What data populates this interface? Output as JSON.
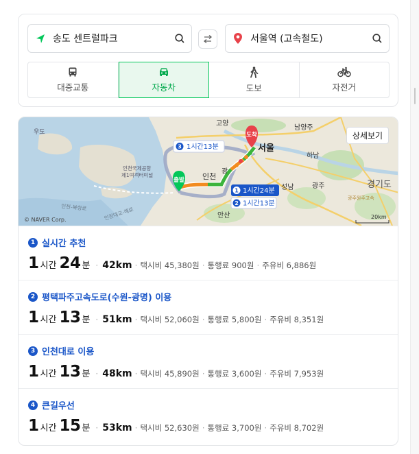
{
  "search": {
    "origin": "송도 센트럴파크",
    "destination": "서울역 (고속철도)"
  },
  "modes": [
    {
      "label": "대중교통",
      "icon": "bus-icon"
    },
    {
      "label": "자동차",
      "icon": "car-icon"
    },
    {
      "label": "도보",
      "icon": "walk-icon"
    },
    {
      "label": "자전거",
      "icon": "bicycle-icon"
    }
  ],
  "selected_mode": "자동차",
  "map": {
    "detail_button": "상세보기",
    "copyright": "© NAVER Corp.",
    "scale": "20km",
    "start_marker": "출발",
    "end_marker": "도착",
    "labels": {
      "seoul": "서울",
      "incheon": "인천",
      "goyang": "고양",
      "namyangju": "남양주",
      "hanam": "하남",
      "seongnam": "성남",
      "gwangju": "광주",
      "gyeonggi": "경기도",
      "ansan": "안산",
      "gwangmyeong": "광",
      "mudo": "우도",
      "airport": "인천국제공항\n제1여객터미널",
      "bridge1": "인천-북항로",
      "bridge2": "인천대교-해로",
      "gwangjuwonju": "광주원주고속"
    },
    "callouts": [
      {
        "num": "3",
        "text": "1시간13분"
      },
      {
        "num": "1",
        "text": "1시간24분"
      },
      {
        "num": "2",
        "text": "1시간13분"
      }
    ]
  },
  "routes": [
    {
      "num": "1",
      "title": "실시간 추천",
      "hours": "1",
      "hour_unit": "시간",
      "minutes": "24",
      "minute_unit": "분",
      "distance": "42km",
      "taxi": "택시비 45,380원",
      "toll": "통행료 900원",
      "fuel": "주유비 6,886원"
    },
    {
      "num": "2",
      "title": "평택파주고속도로(수원-광명) 이용",
      "hours": "1",
      "hour_unit": "시간",
      "minutes": "13",
      "minute_unit": "분",
      "distance": "51km",
      "taxi": "택시비 52,060원",
      "toll": "통행료 5,800원",
      "fuel": "주유비 8,351원"
    },
    {
      "num": "3",
      "title": "인천대로 이용",
      "hours": "1",
      "hour_unit": "시간",
      "minutes": "13",
      "minute_unit": "분",
      "distance": "48km",
      "taxi": "택시비 45,890원",
      "toll": "통행료 3,600원",
      "fuel": "주유비 7,953원"
    },
    {
      "num": "4",
      "title": "큰길우선",
      "hours": "1",
      "hour_unit": "시간",
      "minutes": "15",
      "minute_unit": "분",
      "distance": "53km",
      "taxi": "택시비 52,630원",
      "toll": "통행료 3,700원",
      "fuel": "주유비 8,702원"
    }
  ],
  "colors": {
    "accent_green": "#03c75a",
    "route_blue": "#1a56c8",
    "destination_red": "#e8424a"
  }
}
